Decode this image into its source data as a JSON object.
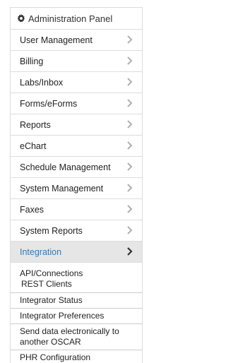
{
  "panel": {
    "title": "Administration Panel",
    "icon": "gear-icon"
  },
  "menu": [
    {
      "label": "User Management"
    },
    {
      "label": "Billing"
    },
    {
      "label": "Labs/Inbox"
    },
    {
      "label": "Forms/eForms"
    },
    {
      "label": "Reports"
    },
    {
      "label": "eChart"
    },
    {
      "label": "Schedule Management"
    },
    {
      "label": "System Management"
    },
    {
      "label": "Faxes"
    },
    {
      "label": "System Reports"
    },
    {
      "label": "Integration",
      "active": true
    }
  ],
  "submenu": {
    "api_connections": "API/Connections",
    "rest_clients": "REST Clients",
    "integrator_status": "Integrator Status",
    "integrator_preferences": "Integrator Preferences",
    "send_data_line1": "Send data electronically to",
    "send_data_line2": "another OSCAR",
    "phr_configuration": "PHR Configuration"
  },
  "colors": {
    "active_text": "#337ab7",
    "active_bg": "#e6e6e6",
    "border": "#dddddd",
    "chevron": "#b0b0b0",
    "chevron_active": "#333333"
  }
}
